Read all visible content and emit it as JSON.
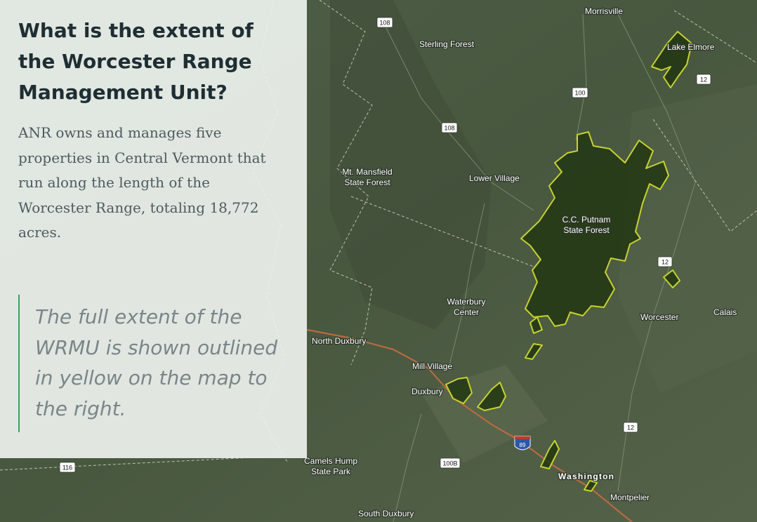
{
  "panel": {
    "title": "What is the extent of the Worcester Range Management Unit?",
    "body": "ANR owns and manages five properties in Central Vermont that run along the length of the Worcester Range, totaling 18,772 acres.",
    "quote": "The full extent of the WRMU is shown outlined in yellow on the map to the right."
  },
  "map": {
    "colors": {
      "background": "#48573f",
      "outline": "#c8d230",
      "fill": "#1f3510",
      "road": "#b86a40"
    },
    "labels": {
      "morrisville": "Morrisville",
      "sterling_forest": "Sterling Forest",
      "lake_elmore": "Lake Elmore",
      "mt_mansfield_1": "Mt. Mansfield",
      "mt_mansfield_2": "State Forest",
      "lower_village": "Lower Village",
      "putnam_1": "C.C. Putnam",
      "putnam_2": "State Forest",
      "waterbury_1": "Waterbury",
      "waterbury_2": "Center",
      "worcester": "Worcester",
      "calais": "Calais",
      "north_duxbury": "North Duxbury",
      "mill_village": "Mill Village",
      "duxbury": "Duxbury",
      "camels_1": "Camels Hump",
      "camels_2": "State Park",
      "washington": "Washington",
      "montpelier": "Montpelier",
      "south_duxbury": "South Duxbury"
    },
    "shields": {
      "r108a": "108",
      "r100": "100",
      "r108b": "108",
      "r12a": "12",
      "r12b": "12",
      "r12c": "12",
      "r100b": "100B",
      "r116": "116",
      "i89": "89"
    }
  }
}
